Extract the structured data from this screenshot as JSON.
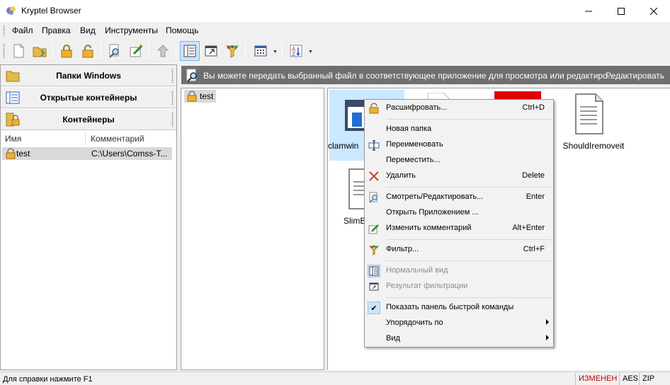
{
  "window": {
    "title": "Kryptel Browser",
    "controls": [
      "minimize-icon",
      "maximize-icon",
      "close-icon"
    ]
  },
  "menu": [
    "Файл",
    "Правка",
    "Вид",
    "Инструменты",
    "Помощь"
  ],
  "toolbar": {
    "buttons": [
      "new-file-icon",
      "open-folder-icon",
      "lock-icon",
      "unlock-icon",
      "view-edit-icon",
      "edit-comment-icon",
      "up-arrow-icon",
      "normal-view-icon",
      "filter-result-icon",
      "filter-icon",
      "view-mode-icon",
      "sort-icon"
    ]
  },
  "nav": {
    "windows_folders": "Папки Windows",
    "open_containers": "Открытые контейнеры",
    "containers": "Контейнеры"
  },
  "containers_table": {
    "headers": [
      "Имя",
      "Комментарий"
    ],
    "rows": [
      {
        "name": "test",
        "comment": "C:\\Users\\Comss-T..."
      }
    ]
  },
  "tree": {
    "root": "test"
  },
  "infobar": {
    "text": "Вы можете передать выбранный файл в соответствующее приложение для просмотра или редактиро...",
    "action": "Редактировать"
  },
  "files": [
    {
      "name": "clamwin",
      "type": "exe"
    },
    {
      "name": "",
      "type": "doc"
    },
    {
      "name": "",
      "type": "pdf"
    },
    {
      "name": "ShouldIremoveit",
      "type": "txt"
    },
    {
      "name": "SlimB",
      "type": "txt"
    }
  ],
  "context_menu": {
    "items": [
      {
        "label": "Расшифровать...",
        "shortcut": "Ctrl+D",
        "icon": "unlock-icon"
      },
      {
        "label": "Новая папка",
        "shortcut": "",
        "icon": ""
      },
      {
        "label": "Переименовать",
        "shortcut": "",
        "icon": "rename-icon"
      },
      {
        "label": "Переместить...",
        "shortcut": "",
        "icon": ""
      },
      {
        "label": "Удалить",
        "shortcut": "Delete",
        "icon": "delete-icon"
      },
      {
        "label": "Смотреть/Редактировать...",
        "shortcut": "Enter",
        "icon": "view-edit-icon"
      },
      {
        "label": "Открыть Приложением ...",
        "shortcut": "",
        "icon": ""
      },
      {
        "label": "Изменить комментарий",
        "shortcut": "Alt+Enter",
        "icon": "edit-comment-icon"
      },
      {
        "label": "Фильтр...",
        "shortcut": "Ctrl+F",
        "icon": "filter-icon"
      },
      {
        "label": "Нормальный вид",
        "shortcut": "",
        "icon": "normal-view-icon"
      },
      {
        "label": "Результат фильтрации",
        "shortcut": "",
        "icon": "filter-result-icon"
      },
      {
        "label": "Показать панель быстрой команды",
        "shortcut": "",
        "icon": "check-icon",
        "checked": true
      },
      {
        "label": "Упорядочить по",
        "shortcut": "",
        "icon": "",
        "submenu": true
      },
      {
        "label": "Вид",
        "shortcut": "",
        "icon": "",
        "submenu": true
      }
    ]
  },
  "status": {
    "help": "Для справки нажмите  F1",
    "modified": "ИЗМЕНЕН",
    "cipher": "AES",
    "compression": "ZIP"
  },
  "colors": {
    "modified": "#c00000",
    "infobar": "#6f6f6f",
    "selection": "#cce8ff"
  }
}
